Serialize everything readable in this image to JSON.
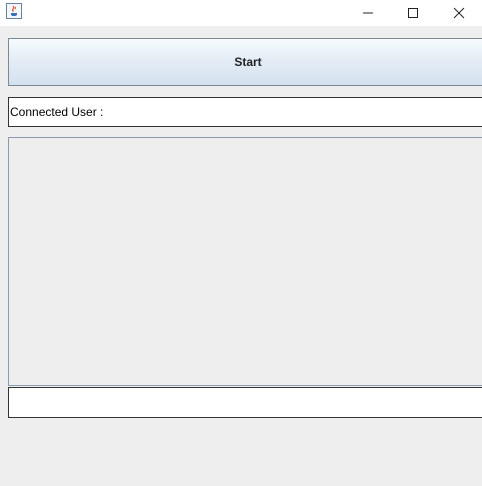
{
  "window": {
    "app_icon": "java-cup-icon",
    "controls": [
      "minimize-icon",
      "maximize-icon",
      "close-icon"
    ]
  },
  "main": {
    "start_label": "Start",
    "connected_user_label": "Connected User :",
    "message_input_value": ""
  }
}
